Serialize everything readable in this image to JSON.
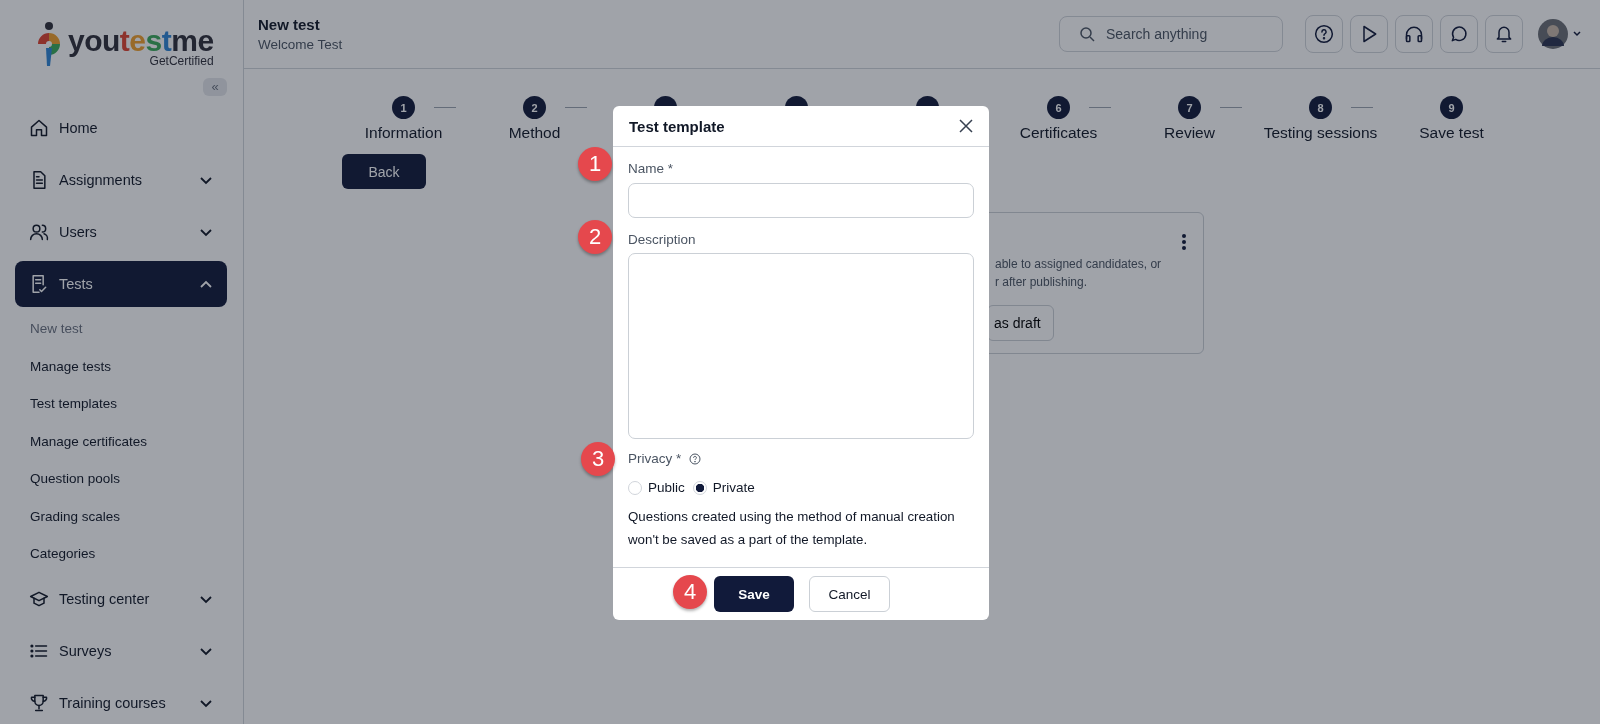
{
  "logo": {
    "name": "youtestme",
    "tagline": "GetCertified"
  },
  "sidebar": {
    "collapse": "«",
    "items": [
      {
        "label": "Home",
        "selected": false
      },
      {
        "label": "Assignments",
        "selected": false,
        "expanded": false
      },
      {
        "label": "Users",
        "selected": false,
        "expanded": false
      },
      {
        "label": "Tests",
        "selected": true,
        "expanded": true,
        "children": [
          {
            "label": "New test",
            "selected": true
          },
          {
            "label": "Manage tests",
            "selected": false
          },
          {
            "label": "Test templates",
            "selected": false
          },
          {
            "label": "Manage certificates",
            "selected": false
          },
          {
            "label": "Question pools",
            "selected": false
          },
          {
            "label": "Grading scales",
            "selected": false
          },
          {
            "label": "Categories",
            "selected": false
          }
        ]
      },
      {
        "label": "Testing center",
        "selected": false,
        "expanded": false
      },
      {
        "label": "Surveys",
        "selected": false,
        "expanded": false
      },
      {
        "label": "Training courses",
        "selected": false,
        "expanded": false
      }
    ]
  },
  "header": {
    "title": "New test",
    "subtitle": "Welcome Test",
    "search": {
      "placeholder": "Search anything"
    }
  },
  "steps": [
    {
      "kind": "step",
      "number": "1",
      "label": "Information"
    },
    {
      "kind": "step",
      "number": "2",
      "label": "Method"
    },
    {
      "kind": "covered"
    },
    {
      "kind": "covered"
    },
    {
      "kind": "covered"
    },
    {
      "kind": "step",
      "number": "6",
      "label": "Certificates"
    },
    {
      "kind": "step",
      "number": "7",
      "label": "Review"
    },
    {
      "kind": "step",
      "number": "8",
      "label": "Testing sessions"
    },
    {
      "kind": "step",
      "number": "9",
      "label": "Save test"
    }
  ],
  "back_button": "Back",
  "card": {
    "lines": [
      "able to assigned candidates, or",
      "r after publishing."
    ],
    "button": "as draft"
  },
  "modal": {
    "title": "Test template",
    "name_label": "Name *",
    "description_label": "Description",
    "privacy_label": "Privacy *",
    "options": [
      {
        "label": "Public",
        "selected": false
      },
      {
        "label": "Private",
        "selected": true
      }
    ],
    "note": "Questions created using the method of manual creation won't be saved as a part of the template.",
    "save": "Save",
    "cancel": "Cancel"
  },
  "annotations": [
    "1",
    "2",
    "3",
    "4"
  ]
}
